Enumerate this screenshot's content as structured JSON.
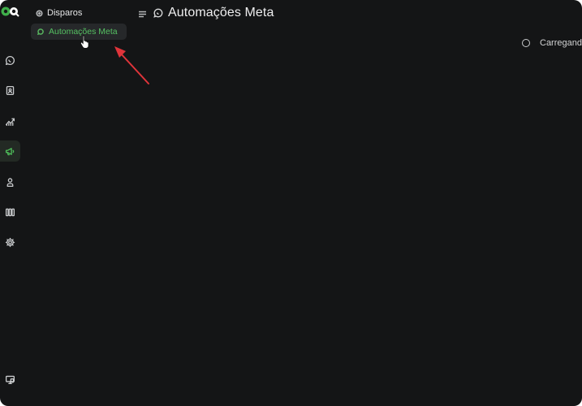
{
  "sidebar": {
    "logo": {
      "icon": "logo-icon",
      "colors": [
        "#3fae4a",
        "#ffffff"
      ]
    },
    "items": [
      {
        "id": "chat",
        "icon": "chat-bubble-icon",
        "active": false
      },
      {
        "id": "contacts",
        "icon": "contact-book-icon",
        "active": false
      },
      {
        "id": "reports",
        "icon": "trend-chart-icon",
        "active": false
      },
      {
        "id": "campaigns",
        "icon": "megaphone-icon",
        "active": true
      },
      {
        "id": "users",
        "icon": "user-stack-icon",
        "active": false
      },
      {
        "id": "kanban",
        "icon": "columns-icon",
        "active": false
      },
      {
        "id": "settings",
        "icon": "gear-icon",
        "active": false
      }
    ],
    "footer_item": {
      "id": "screen",
      "icon": "monitor-icon"
    }
  },
  "subnav": {
    "group_icon": "broadcast-icon",
    "group_title": "Disparos",
    "items": [
      {
        "label": "Automações Meta",
        "icon": "chat-bubble-icon",
        "active": true
      }
    ]
  },
  "header": {
    "menu_icon": "menu-lines-icon",
    "title_icon": "chat-bubble-icon",
    "title": "Automações Meta"
  },
  "main": {
    "loading_text": "Carregand",
    "loading_icon": "spinner-icon"
  },
  "colors": {
    "background": "#141516",
    "accent": "#4fbf5a",
    "annotation_arrow": "#e0343a"
  }
}
